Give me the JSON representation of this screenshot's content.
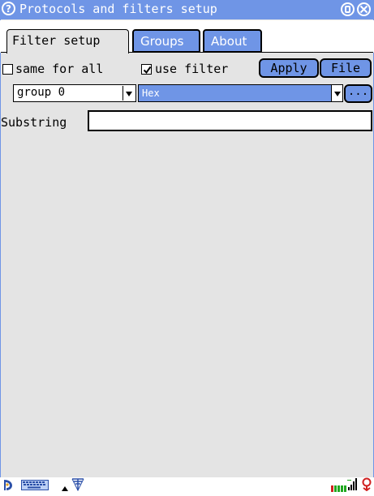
{
  "window": {
    "title": "Protocols and filters setup",
    "help_glyph": "?"
  },
  "tabs": [
    {
      "label": "Filter setup",
      "active": true
    },
    {
      "label": "Groups",
      "active": false
    },
    {
      "label": "About",
      "active": false
    }
  ],
  "filter_row": {
    "same_for_all_label": "same for all",
    "same_for_all_checked": false,
    "use_filter_label": "use filter",
    "use_filter_checked": true,
    "apply_label": "Apply",
    "file_label": "File"
  },
  "selectors": {
    "group_value": "group 0",
    "format_value": "Hex",
    "more_label": "..."
  },
  "substring": {
    "label": "Substring",
    "value": ""
  },
  "taskbar": {
    "icons": [
      "start-menu-icon",
      "keyboard-icon",
      "menu-arrow-up-icon",
      "network-antenna-icon",
      "battery-icon",
      "volume-icon",
      "power-icon"
    ]
  },
  "colors": {
    "accent": "#6f95e6",
    "panel": "#e4e4e4",
    "battery_green": "#1fa81f",
    "battery_red": "#d02020"
  }
}
